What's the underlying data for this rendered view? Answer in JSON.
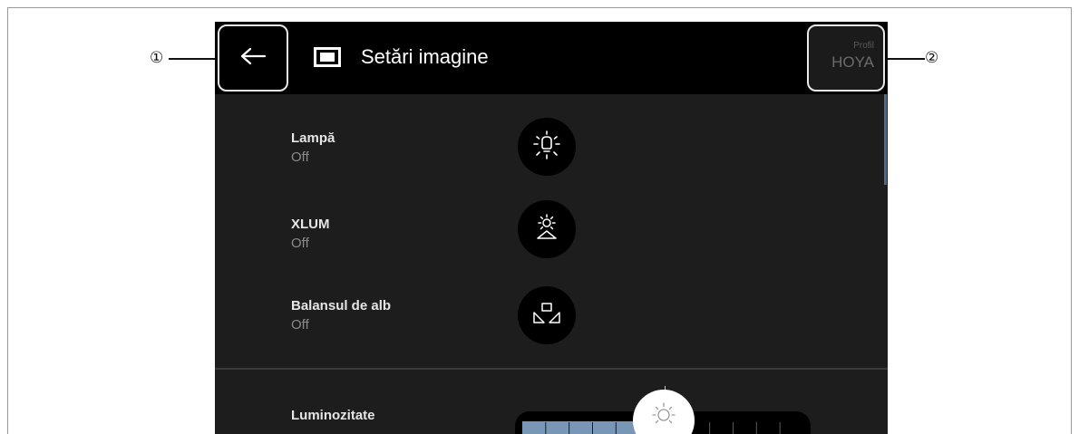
{
  "header": {
    "title": "Setări imagine",
    "profile_label": "Profil",
    "profile_value": "HOYA"
  },
  "settings": [
    {
      "label": "Lampă",
      "status": "Off",
      "icon": "lamp-icon"
    },
    {
      "label": "XLUM",
      "status": "Off",
      "icon": "xlum-icon"
    },
    {
      "label": "Balansul de alb",
      "status": "Off",
      "icon": "white-balance-icon"
    }
  ],
  "brightness": {
    "label": "Luminozitate",
    "level_fraction": 0.42
  },
  "callouts": {
    "back": "①",
    "profile": "②"
  },
  "colors": {
    "background": "#1d1d1d",
    "header": "#000000",
    "accent": "#7996b6",
    "scrollbar": "#486c93"
  }
}
